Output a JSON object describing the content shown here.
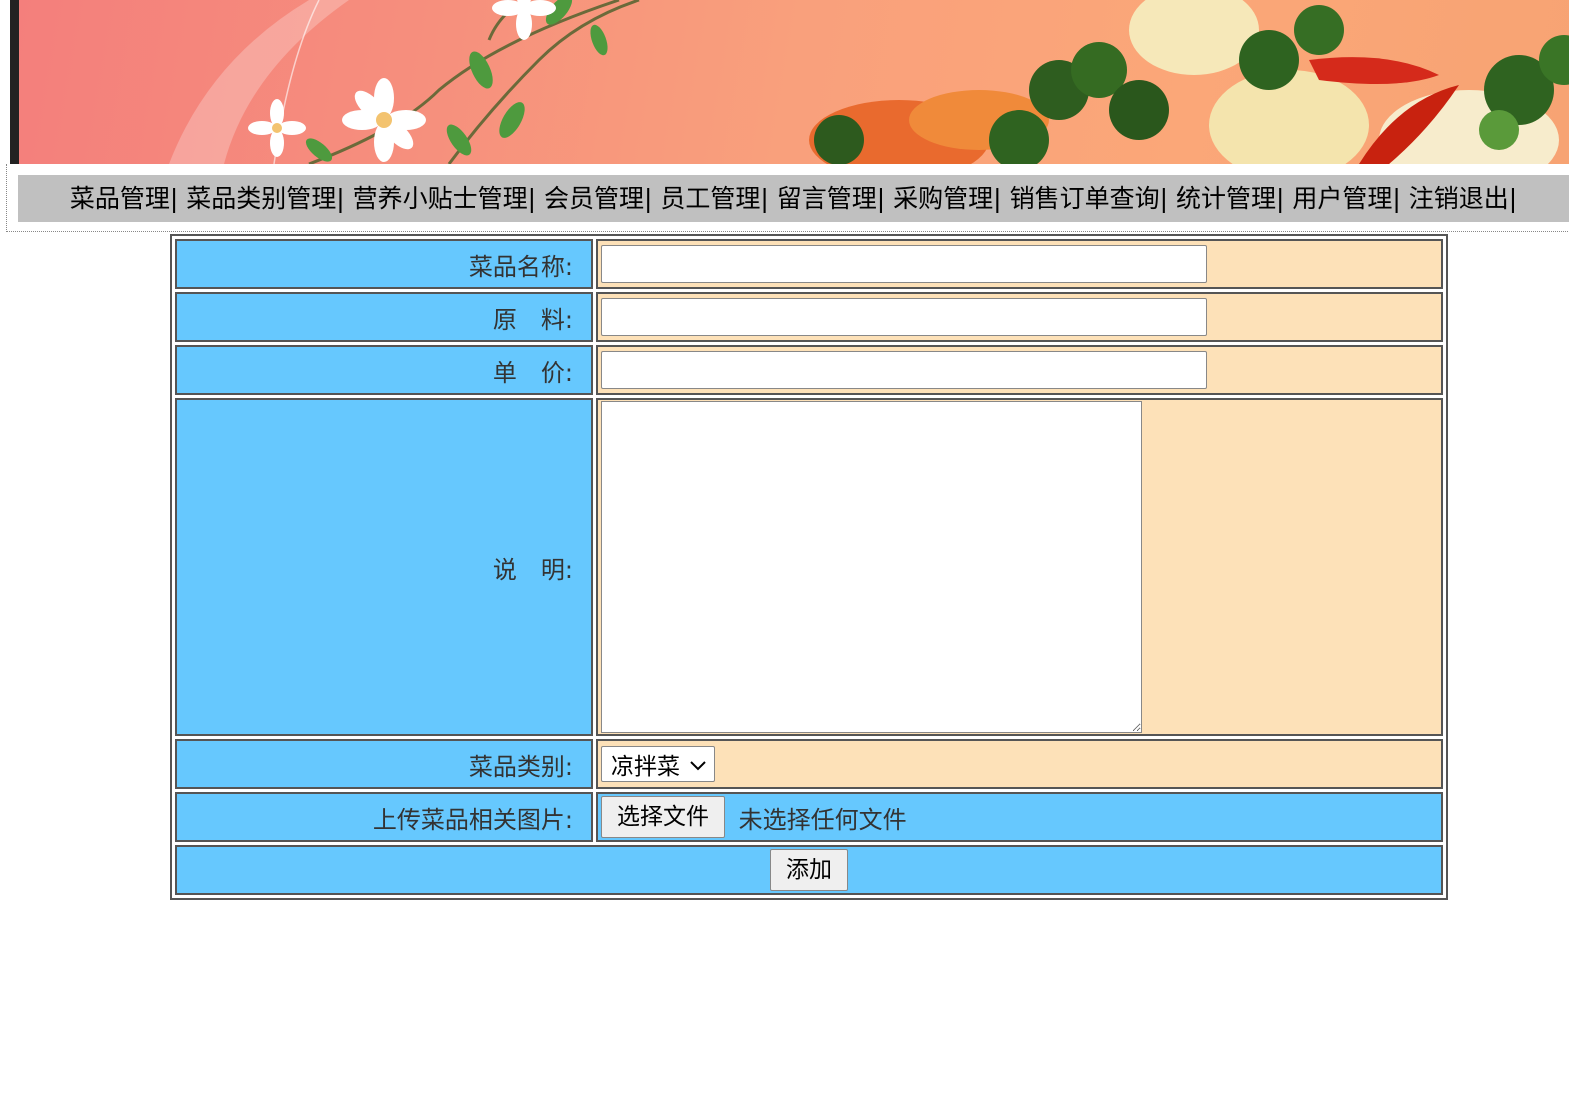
{
  "nav": {
    "items": [
      "菜品管理|",
      "菜品类别管理|",
      "营养小贴士管理|",
      "会员管理|",
      "员工管理|",
      "留言管理|",
      "采购管理|",
      "销售订单查询|",
      "统计管理|",
      "用户管理|",
      "注销退出|"
    ]
  },
  "form": {
    "name_label": "菜品名称:",
    "name_value": "",
    "material_label": "原　料:",
    "material_value": "",
    "price_label": "单　价:",
    "price_value": "",
    "desc_label": "说　明:",
    "desc_value": "",
    "category_label": "菜品类别:",
    "category_selected": "凉拌菜",
    "upload_label": "上传菜品相关图片:",
    "upload_button": "选择文件",
    "upload_status": "未选择任何文件",
    "submit_label": "添加"
  },
  "colors": {
    "label_bg": "#66c8fe",
    "value_bg": "#fde1b8",
    "nav_bg": "#c0c0c0"
  }
}
